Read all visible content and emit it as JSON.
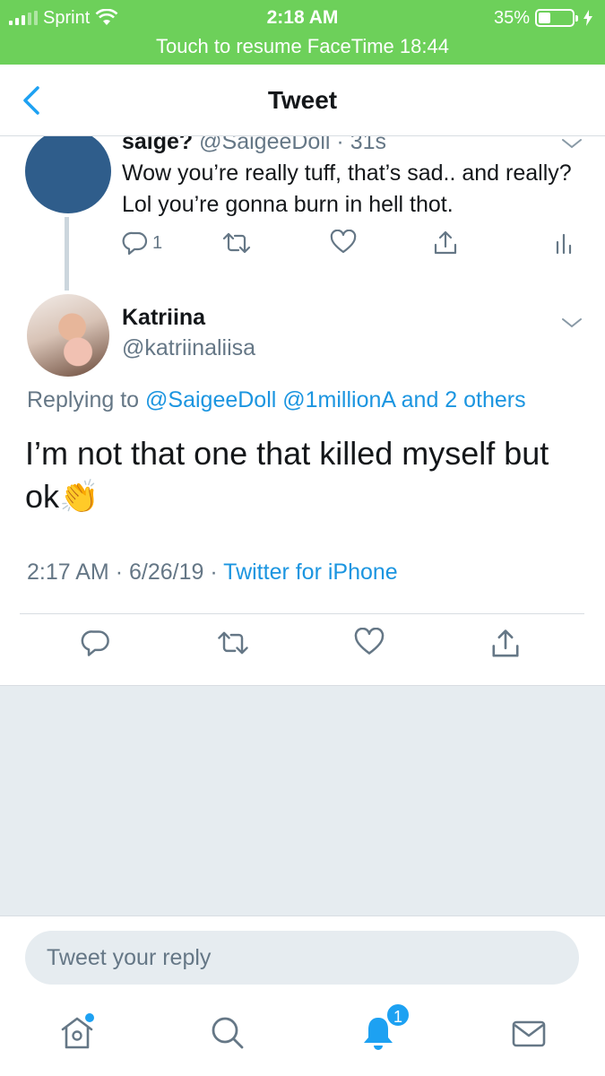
{
  "status_bar": {
    "carrier": "Sprint",
    "time": "2:18 AM",
    "battery": "35%",
    "battery_level": 0.35,
    "banner": "Touch to resume FaceTime 18:44",
    "background": "#6dd05a"
  },
  "header": {
    "title": "Tweet",
    "back_icon": "chevron-left-icon",
    "accent": "#1da1f2"
  },
  "parent_tweet": {
    "name": "saige?",
    "handle": "@SaigeeDoll",
    "age": "31s",
    "separator": "·",
    "text": "Wow you’re really tuff, that’s sad.. and really? Lol you’re gonna burn in hell thot.",
    "reply_count": "1",
    "avatar_color": "#2f5d8b"
  },
  "main_tweet": {
    "name": "Katriina",
    "handle": "@katriinaliisa",
    "replying_prefix": "Replying to",
    "mentions": "@SaigeeDoll @1millionA and 2 others",
    "text": "I’m not that one that killed myself but ok",
    "emoji": "👏",
    "time": "2:17 AM",
    "date": "6/26/19",
    "client": "Twitter for iPhone",
    "separator": "·"
  },
  "reply": {
    "placeholder": "Tweet your reply"
  },
  "tabbar": {
    "notifications_badge": "1",
    "items": [
      "home-icon",
      "search-icon",
      "bell-icon",
      "mail-icon"
    ]
  }
}
